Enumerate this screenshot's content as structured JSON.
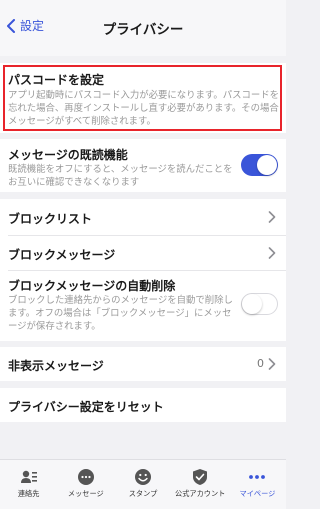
{
  "nav": {
    "back_label": "設定",
    "title": "プライバシー"
  },
  "passcode": {
    "title": "パスコードを設定",
    "desc": [
      "アプリ起動時にパスコード入力が必要になります。パスコードを",
      "忘れた場合、再度インストールし直す必要があります。その場合",
      "メッセージがすべて削除されます。"
    ]
  },
  "read_receipt": {
    "title": "メッセージの既読機能",
    "desc": [
      "既読機能をオフにすると、メッセージを読んだことを",
      "お互いに確認できなくなります"
    ],
    "enabled": true
  },
  "block_list": {
    "title": "ブロックリスト"
  },
  "block_messages": {
    "title": "ブロックメッセージ"
  },
  "auto_delete": {
    "title": "ブロックメッセージの自動削除",
    "desc": [
      "ブロックした連絡先からのメッセージを自動で削除し",
      "ます。オフの場合は「ブロックメッセージ」にメッセ",
      "ージが保存されます。"
    ],
    "enabled": false
  },
  "hidden_messages": {
    "title": "非表示メッセージ",
    "count": "0"
  },
  "reset": {
    "title": "プライバシー設定をリセット"
  },
  "tabs": [
    {
      "label": "連絡先",
      "icon": "contacts-icon",
      "active": false
    },
    {
      "label": "メッセージ",
      "icon": "message-icon",
      "active": false
    },
    {
      "label": "スタンプ",
      "icon": "sticker-icon",
      "active": false
    },
    {
      "label": "公式アカウント",
      "icon": "official-account-icon",
      "active": false
    },
    {
      "label": "マイページ",
      "icon": "more-icon",
      "active": true
    }
  ],
  "colors": {
    "accent": "#3a55d9",
    "highlight_border": "#e8242b",
    "background": "#f1f1f4"
  }
}
